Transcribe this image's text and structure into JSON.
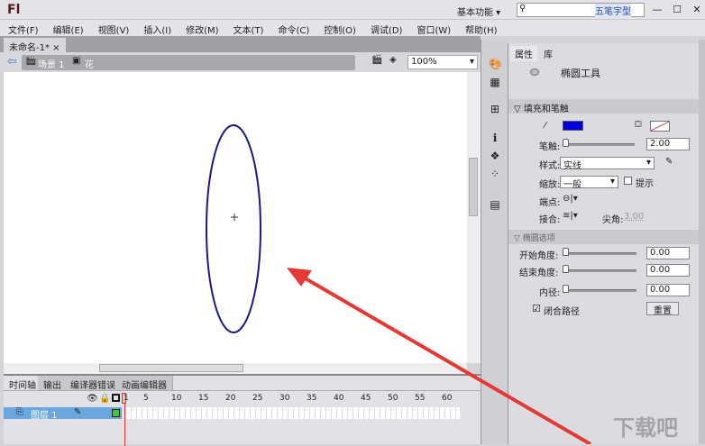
{
  "app": {
    "logo": "Fl",
    "workspace": "基本功能",
    "ime": "五笔字型",
    "minimize": "—",
    "maximize": "☐",
    "close": "✕"
  },
  "menu": [
    "文件(F)",
    "编辑(E)",
    "视图(V)",
    "插入(I)",
    "修改(M)",
    "文本(T)",
    "命令(C)",
    "控制(O)",
    "调试(D)",
    "窗口(W)",
    "帮助(H)"
  ],
  "document": {
    "tab": "未命名-1*",
    "close": "×",
    "scene": "场景 1",
    "symbol": "花",
    "zoom": "100%"
  },
  "timeline": {
    "tabs": [
      "时间轴",
      "输出",
      "编译器错误",
      "动画编辑器"
    ],
    "frame_numbers": [
      "1",
      "5",
      "10",
      "15",
      "20",
      "25",
      "30",
      "35",
      "40",
      "45",
      "50",
      "55",
      "60"
    ],
    "layer": "图层 1"
  },
  "properties": {
    "tabs": [
      "属性",
      "库"
    ],
    "tool": "椭圆工具",
    "fill_stroke": {
      "title": "填充和笔触",
      "stroke_color": "#0000dd",
      "stroke_label": "笔触:",
      "stroke_value": "2.00",
      "style_label": "样式:",
      "style_value": "实线",
      "scale_label": "缩放:",
      "scale_value": "一般",
      "hint_label": "提示",
      "cap_label": "端点:",
      "join_label": "接合:",
      "miter_label": "尖角:",
      "miter_value": "3.00"
    },
    "ellipse": {
      "title": "椭圆选项",
      "start_label": "开始角度:",
      "start_value": "0.00",
      "end_label": "结束角度:",
      "end_value": "0.00",
      "inner_label": "内径:",
      "inner_value": "0.00",
      "close_path_label": "闭合路径",
      "close_path_checked": true,
      "reset": "重置"
    }
  },
  "watermark": "下载吧"
}
